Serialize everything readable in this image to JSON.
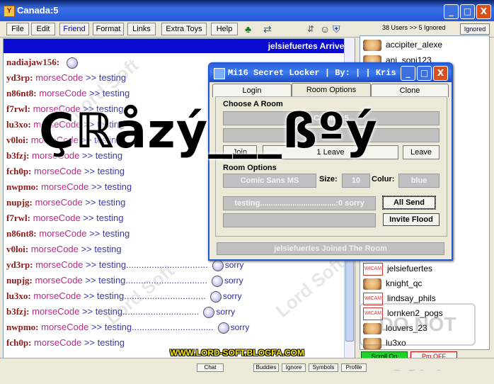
{
  "window": {
    "title": "Canada:5",
    "min": "_",
    "max": "□",
    "close": "X"
  },
  "menu": [
    "File",
    "Edit",
    "Friend",
    "Format",
    "Links",
    "Extra Toys",
    "Help"
  ],
  "users_count": "38 Users >> 5 Ignored",
  "ignored_label": "Ignored",
  "chat": {
    "arrival": "jelsiefuertes  Arrives",
    "lines": [
      {
        "nick": "nadiajaw156:",
        "code": "",
        "msg": "",
        "smiley": true
      },
      {
        "nick": "yd3rp:",
        "code": "morseCode",
        "msg": ">> testing"
      },
      {
        "nick": "n86nt8:",
        "code": "morseCode",
        "msg": ">> testing"
      },
      {
        "nick": "f7rwl:",
        "code": "morseCode",
        "msg": ">> testing"
      },
      {
        "nick": "lu3xo:",
        "code": "morseCode",
        "msg": ">> testing"
      },
      {
        "nick": "v0loi:",
        "code": "morseCode",
        "msg": ">> testing"
      },
      {
        "nick": "b3fzj:",
        "code": "morseCode",
        "msg": ">> testing"
      },
      {
        "nick": "fch0p:",
        "code": "morseCode",
        "msg": ">> testing"
      },
      {
        "nick": "nwpmo:",
        "code": "morseCode",
        "msg": ">> testing"
      },
      {
        "nick": "nupjg:",
        "code": "morseCode",
        "msg": ">> testing"
      },
      {
        "nick": "f7rwl:",
        "code": "morseCode",
        "msg": ">> testing"
      },
      {
        "nick": "n86nt8:",
        "code": "morseCode",
        "msg": ">> testing"
      },
      {
        "nick": "v0loi:",
        "code": "morseCode",
        "msg": ">> testing"
      },
      {
        "nick": "yd3rp:",
        "code": "morseCode",
        "msg": ">> testing................................",
        "sorry": "sorry"
      },
      {
        "nick": "nupjg:",
        "code": "morseCode",
        "msg": ">> testing................................",
        "sorry": "sorry"
      },
      {
        "nick": "lu3xo:",
        "code": "morseCode",
        "msg": ">> testing................................",
        "sorry": "sorry"
      },
      {
        "nick": "b3fzj:",
        "code": "morseCode",
        "msg": ">> testing..............................",
        "sorry": "sorry"
      },
      {
        "nick": "nwpmo:",
        "code": "morseCode",
        "msg": ">> testing................................",
        "sorry": "sorry"
      },
      {
        "nick": "fch0p:",
        "code": "morseCode",
        "msg": ">> testing",
        "sorry": ""
      }
    ]
  },
  "users": [
    {
      "name": "accipiter_alexe",
      "avatar": "face"
    },
    {
      "name": "ani_soni123",
      "avatar": "face"
    },
    {
      "name": "jelsiefuertes",
      "avatar": "cam"
    },
    {
      "name": "knight_qc",
      "avatar": "face"
    },
    {
      "name": "lindsay_phils",
      "avatar": "cam"
    },
    {
      "name": "lornken2_pogs",
      "avatar": "cam"
    },
    {
      "name": "louvers_23",
      "avatar": "face"
    },
    {
      "name": "lu3xo",
      "avatar": "face"
    }
  ],
  "cam_label": "WICAM",
  "scroll_on": "Scroll On",
  "pm_off": "Pm OFF",
  "bottom_tabs": [
    "Chat",
    "Buddies",
    "Ignore",
    "Symbols",
    "Profile"
  ],
  "locker": {
    "title": "Mi16 Secret Locker  | By: | | Kris",
    "min": "_",
    "max": "□",
    "close": "X",
    "tabs": [
      "Login",
      "Room Options",
      "Clone"
    ],
    "choose_room": "Choose A Room",
    "room_value": "Canada:5",
    "join_label": "Join",
    "leave_label": "1 Leave",
    "leave2_label": "Leave",
    "room_options_label": "Room Options",
    "font_value": "Comic Sans MS",
    "size_label": "Size:",
    "size_value": "10",
    "colour_label": "Colur:",
    "colour_value": "blue",
    "message_value": "testing...................................:0 sorry",
    "all_send": "All Send",
    "invite_flood": "Invite Flood",
    "status": "jelsiefuertes  Joined The Room"
  },
  "overlay_text": "Çℝåzý___ßºý",
  "footer_url": "WWW.LORD-SOFT.BLOGFA.COM",
  "watermark": "Lord Soft",
  "copy_watermark": "DO NOT COPY"
}
